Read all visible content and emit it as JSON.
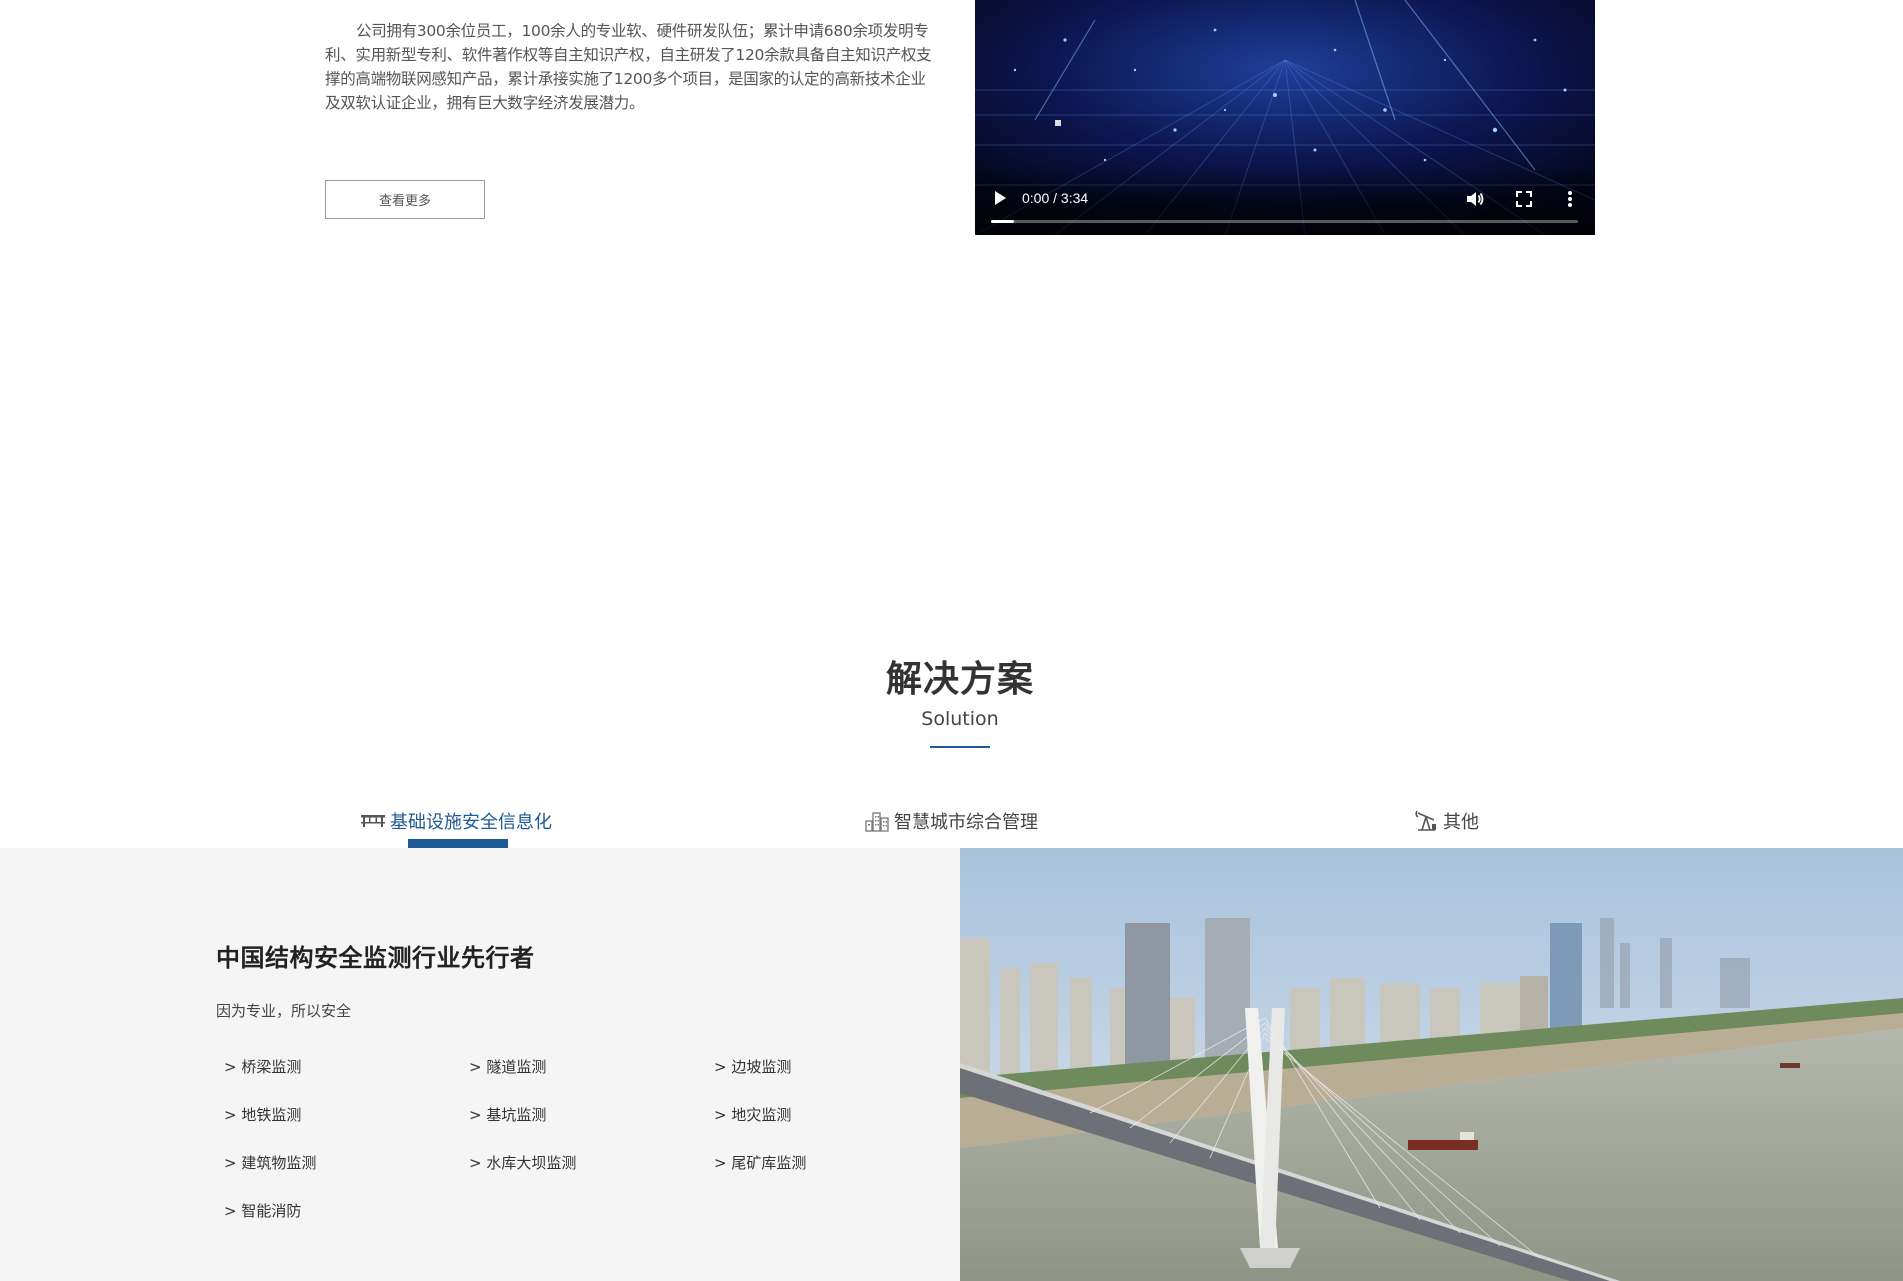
{
  "about": {
    "text": "公司拥有300余位员工，100余人的专业软、硬件研发队伍；累计申请680余项发明专利、实用新型专利、软件著作权等自主知识产权，自主研发了120余款具备自主知识产权支撑的高端物联网感知产品，累计承接实施了1200多个项目，是国家的认定的高新技术企业及双软认证企业，拥有巨大数字经济发展潜力。",
    "more_label": "查看更多"
  },
  "video": {
    "time": "0:00 / 3:34",
    "progress": 0.04,
    "icons": {
      "play": "play-icon",
      "volume": "volume-icon",
      "fullscreen": "fullscreen-icon",
      "more": "more-options-icon"
    }
  },
  "solution": {
    "title": "解决方案",
    "subtitle": "Solution",
    "accent_color": "#1e5a96",
    "tabs": [
      {
        "label": "基础设施安全信息化",
        "icon": "bridge-icon",
        "active": true
      },
      {
        "label": "智慧城市综合管理",
        "icon": "city-buildings-icon",
        "active": false
      },
      {
        "label": "其他",
        "icon": "oil-pump-icon",
        "active": false
      }
    ],
    "panel": {
      "heading": "中国结构安全监测行业先行者",
      "tagline": "因为专业，所以安全",
      "links": [
        "> 桥梁监测",
        "> 隧道监测",
        "> 边坡监测",
        "> 地铁监测",
        "> 基坑监测",
        "> 地灾监测",
        "> 建筑物监测",
        "> 水库大坝监测",
        "> 尾矿库监测",
        "> 智能消防"
      ]
    },
    "photo": "cable-stayed-bridge-city-photo"
  }
}
